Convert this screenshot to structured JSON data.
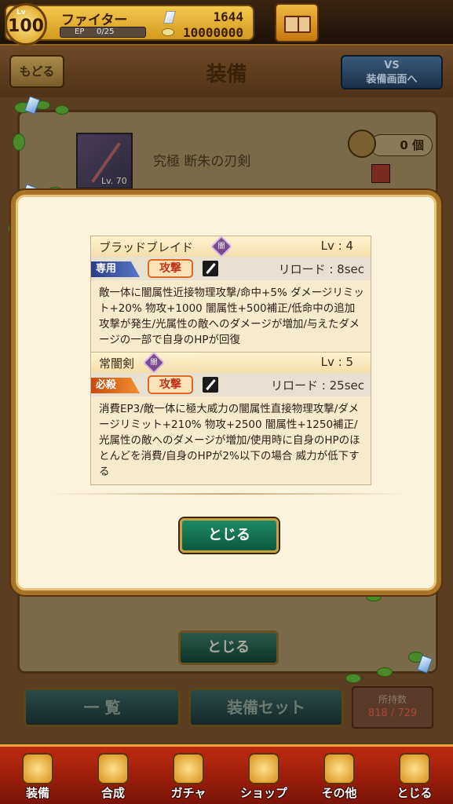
{
  "status": {
    "level_label": "Lv",
    "level": "100",
    "name": "ファイター",
    "ep_label": "EP",
    "ep_value": "0/25",
    "ep_fraction": 0.0,
    "gems": "1644",
    "coins": "10000000"
  },
  "header": {
    "back_label": "もどる",
    "title": "装備",
    "vs_label_line1": "VS",
    "vs_label_line2": "装備画面へ"
  },
  "item": {
    "name": "究極 断朱の刃剣",
    "thumb_level": "Lv. 70",
    "count": "0 個"
  },
  "skills": [
    {
      "name": "ブラッドブレイド",
      "element_label": "闇",
      "level": "Lv : 4",
      "type_tag": "専用",
      "attack_label": "攻撃",
      "reload": "リロード : 8sec",
      "description": "敵一体に闇属性近接物理攻撃/命中+5% ダメージリミット+20% 物攻+1000 闇属性+500補正/低命中の追加攻撃が発生/光属性の敵へのダメージが増加/与えたダメージの一部で自身のHPが回復"
    },
    {
      "name": "常闇剣",
      "element_label": "闇",
      "level": "Lv : 5",
      "type_tag": "必殺",
      "attack_label": "攻撃",
      "reload": "リロード : 25sec",
      "description": "消費EP3/敵一体に極大威力の闇属性直接物理攻撃/ダメージリミット+210% 物攻+2500 闇属性+1250補正/光属性の敵へのダメージが増加/使用時に自身のHPのほとんどを消費/自身のHPが2%以下の場合 威力が低下する"
    }
  ],
  "modal": {
    "close_label": "とじる"
  },
  "scene": {
    "close_label": "とじる",
    "list_label": "一 覧",
    "set_label": "装備セット",
    "owned_label": "所持数",
    "owned_value": "818 / 729"
  },
  "nav": [
    {
      "label": "装備",
      "icon": "sword-shield-icon"
    },
    {
      "label": "合成",
      "icon": "hammer-icon"
    },
    {
      "label": "ガチャ",
      "icon": "gacha-icon"
    },
    {
      "label": "ショップ",
      "icon": "crystal-shop-icon"
    },
    {
      "label": "その他",
      "icon": "gear-icon"
    },
    {
      "label": "とじる",
      "icon": "close-icon"
    }
  ],
  "colors": {
    "accent_gold": "#d39a1e",
    "nav_red": "#c02a10",
    "close_button_green": "#1e8a66",
    "attack_red": "#c0361a"
  }
}
